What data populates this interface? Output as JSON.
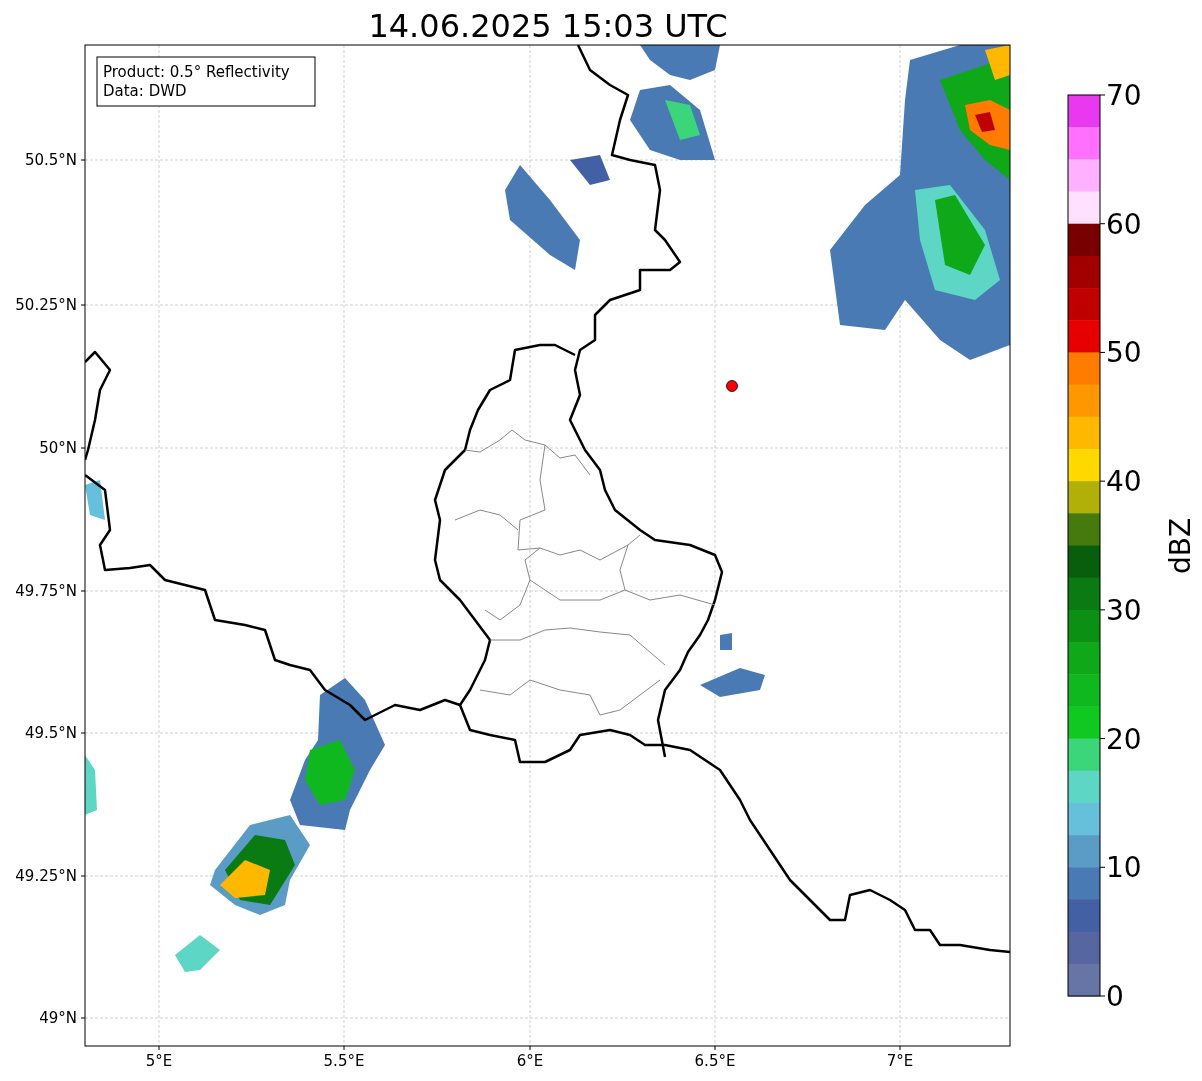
{
  "title": "14.06.2025 15:03 UTC",
  "map": {
    "info_box": [
      "Product: 0.5° Reflectivity",
      "Data: DWD"
    ],
    "lat_labels": [
      "50.5°N",
      "50.25°N",
      "50°N",
      "49.75°N",
      "49.5°N",
      "49.25°N",
      "49°N"
    ],
    "lon_labels": [
      "5°E",
      "5.5°E",
      "6°E",
      "6.5°E",
      "7°E"
    ]
  },
  "colorbar": {
    "label": "dBZ",
    "ticks": [
      "70",
      "60",
      "50",
      "40",
      "30",
      "20",
      "10",
      "0"
    ],
    "bins": [
      {
        "color": "#e838f0"
      },
      {
        "color": "#ff70ff"
      },
      {
        "color": "#ffb0ff"
      },
      {
        "color": "#ffe0ff"
      },
      {
        "color": "#780000"
      },
      {
        "color": "#a00000"
      },
      {
        "color": "#c00000"
      },
      {
        "color": "#e60000"
      },
      {
        "color": "#ff7c00"
      },
      {
        "color": "#ff9800"
      },
      {
        "color": "#ffb800"
      },
      {
        "color": "#ffd800"
      },
      {
        "color": "#b0b008"
      },
      {
        "color": "#467a0c"
      },
      {
        "color": "#085e0c"
      },
      {
        "color": "#0a7a12"
      },
      {
        "color": "#0c9014"
      },
      {
        "color": "#0ea818"
      },
      {
        "color": "#10b820"
      },
      {
        "color": "#10c820"
      },
      {
        "color": "#3cd67a"
      },
      {
        "color": "#5ed6c6"
      },
      {
        "color": "#66c0dc"
      },
      {
        "color": "#5a9cc6"
      },
      {
        "color": "#4a7ab4"
      },
      {
        "color": "#4460a4"
      },
      {
        "color": "#5566a0"
      },
      {
        "color": "#6674a6"
      }
    ]
  }
}
